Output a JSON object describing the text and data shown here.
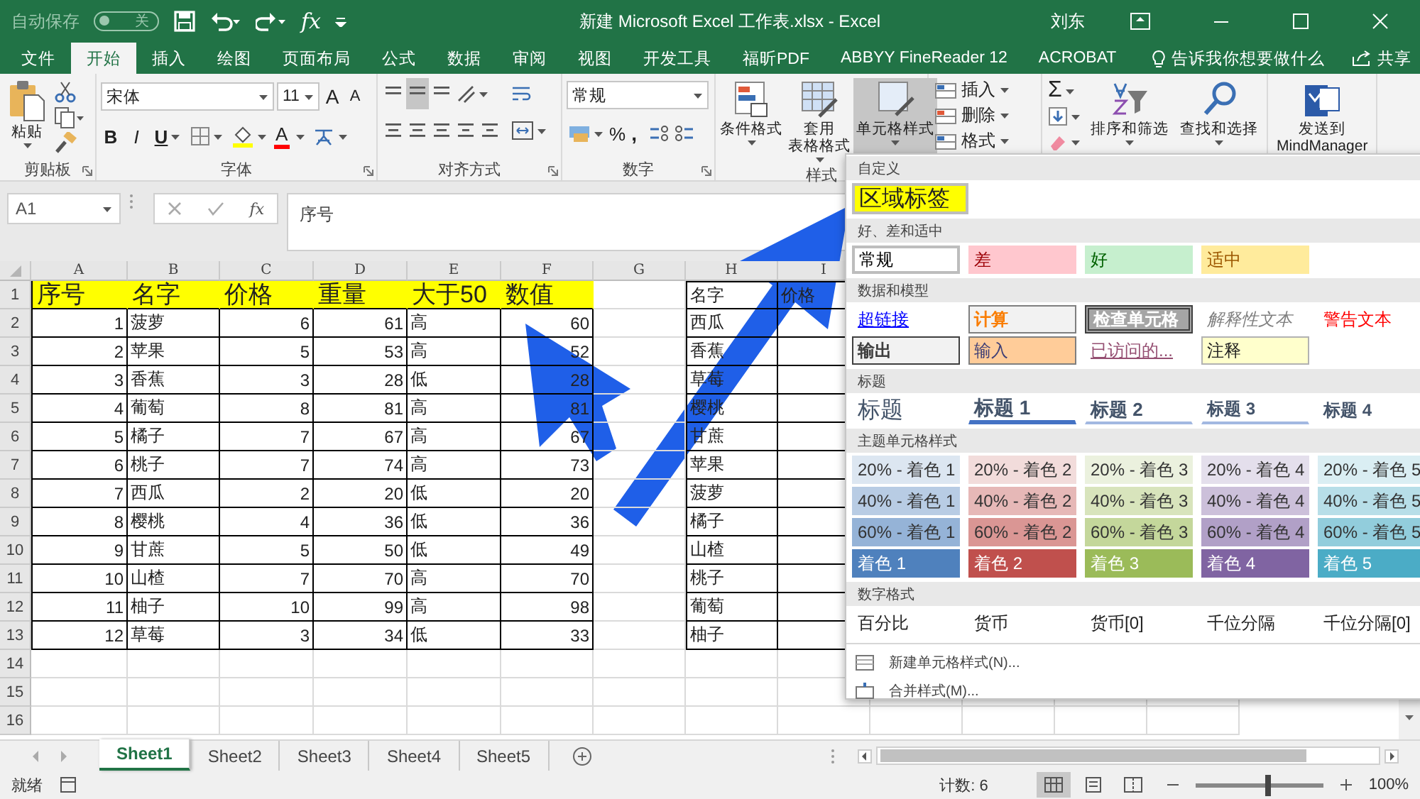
{
  "title_bar": {
    "autosave": {
      "label": "自动保存",
      "state": "关",
      "on": false
    },
    "fx": "fx",
    "title": "新建 Microsoft Excel 工作表.xlsx  -  Excel",
    "user": "刘东"
  },
  "ribbon_tabs": [
    {
      "label": "文件",
      "selected": false
    },
    {
      "label": "开始",
      "selected": true
    },
    {
      "label": "插入",
      "selected": false
    },
    {
      "label": "绘图",
      "selected": false
    },
    {
      "label": "页面布局",
      "selected": false
    },
    {
      "label": "公式",
      "selected": false
    },
    {
      "label": "数据",
      "selected": false
    },
    {
      "label": "审阅",
      "selected": false
    },
    {
      "label": "视图",
      "selected": false
    },
    {
      "label": "开发工具",
      "selected": false
    },
    {
      "label": "福昕PDF",
      "selected": false
    },
    {
      "label": "ABBYY FineReader 12",
      "selected": false
    },
    {
      "label": "ACROBAT",
      "selected": false
    }
  ],
  "tell_me": "告诉我你想要做什么",
  "share": "共享",
  "ribbon": {
    "clipboard": {
      "paste": "粘贴",
      "label": "剪贴板"
    },
    "font": {
      "name": "宋体",
      "size": "11",
      "grow": "A",
      "shrink": "A",
      "bold": "B",
      "italic": "I",
      "underline": "U",
      "color_letter": "A",
      "label": "字体"
    },
    "alignment": {
      "vertical_align": [
        {
          "selected": false
        },
        {
          "selected": true
        },
        {
          "selected": false
        }
      ],
      "label": "对齐方式"
    },
    "number": {
      "format": "常规",
      "percent": "%",
      "comma": ",",
      "label": "数字"
    },
    "styles": {
      "buttons": [
        {
          "lines": [
            "条件格式"
          ],
          "selected": false
        },
        {
          "lines": [
            "套用",
            "表格格式"
          ],
          "selected": false
        },
        {
          "lines": [
            "单元格样式"
          ],
          "selected": true
        }
      ],
      "label": "样式"
    },
    "cells": [
      "插入",
      "删除",
      "格式"
    ],
    "editing": {
      "sum": "Σ",
      "buttons": [
        "排序和筛选",
        "查找和选择"
      ]
    },
    "send_to": [
      "发送到",
      "MindManager"
    ]
  },
  "formula_bar": {
    "name_box": "A1",
    "fx": "fx",
    "formula": "序号"
  },
  "sheet": {
    "columns": [
      "A",
      "B",
      "C",
      "D",
      "E",
      "F",
      "G",
      "H",
      "I"
    ],
    "rows": [
      {
        "header": "1",
        "highlighted": true,
        "table": [
          "序号",
          "名字",
          "价格",
          "重量",
          "大于50",
          "数值"
        ],
        "list": [
          "名字",
          "价格"
        ]
      },
      {
        "header": "2",
        "highlighted": false,
        "table": [
          "1",
          "菠萝",
          "6",
          "61",
          "高",
          "60"
        ],
        "list": [
          "西瓜"
        ]
      },
      {
        "header": "3",
        "highlighted": false,
        "table": [
          "2",
          "苹果",
          "5",
          "53",
          "高",
          "52"
        ],
        "list": [
          "香蕉"
        ]
      },
      {
        "header": "4",
        "highlighted": false,
        "table": [
          "3",
          "香蕉",
          "3",
          "28",
          "低",
          "28"
        ],
        "list": [
          "草莓"
        ]
      },
      {
        "header": "5",
        "highlighted": false,
        "table": [
          "4",
          "葡萄",
          "8",
          "81",
          "高",
          "81"
        ],
        "list": [
          "樱桃"
        ]
      },
      {
        "header": "6",
        "highlighted": false,
        "table": [
          "5",
          "橘子",
          "7",
          "67",
          "高",
          "67"
        ],
        "list": [
          "甘蔗"
        ]
      },
      {
        "header": "7",
        "highlighted": false,
        "table": [
          "6",
          "桃子",
          "7",
          "74",
          "高",
          "73"
        ],
        "list": [
          "苹果"
        ]
      },
      {
        "header": "8",
        "highlighted": false,
        "table": [
          "7",
          "西瓜",
          "2",
          "20",
          "低",
          "20"
        ],
        "list": [
          "菠萝"
        ]
      },
      {
        "header": "9",
        "highlighted": false,
        "table": [
          "8",
          "樱桃",
          "4",
          "36",
          "低",
          "36"
        ],
        "list": [
          "橘子"
        ]
      },
      {
        "header": "10",
        "highlighted": false,
        "table": [
          "9",
          "甘蔗",
          "5",
          "50",
          "低",
          "49"
        ],
        "list": [
          "山楂"
        ]
      },
      {
        "header": "11",
        "highlighted": false,
        "table": [
          "10",
          "山楂",
          "7",
          "70",
          "高",
          "70"
        ],
        "list": [
          "桃子"
        ]
      },
      {
        "header": "12",
        "highlighted": false,
        "table": [
          "11",
          "柚子",
          "10",
          "99",
          "高",
          "98"
        ],
        "list": [
          "葡萄"
        ]
      },
      {
        "header": "13",
        "highlighted": false,
        "table": [
          "12",
          "草莓",
          "3",
          "34",
          "低",
          "33"
        ],
        "list": [
          "柚子"
        ]
      },
      {
        "header": "14"
      },
      {
        "header": "15"
      },
      {
        "header": "16"
      }
    ]
  },
  "sheet_tabs": [
    {
      "label": "Sheet1",
      "selected": true
    },
    {
      "label": "Sheet2",
      "selected": false
    },
    {
      "label": "Sheet3",
      "selected": false
    },
    {
      "label": "Sheet4",
      "selected": false
    },
    {
      "label": "Sheet5",
      "selected": false
    }
  ],
  "status_bar": {
    "ready": "就绪",
    "count": "计数: 6",
    "views": [
      {
        "selected": true
      },
      {
        "selected": false
      },
      {
        "selected": false
      }
    ],
    "zoom_slider": {
      "level": 0.55
    },
    "zoom": "100%"
  },
  "cell_styles_menu": {
    "sections": [
      {
        "title": "自定义",
        "items": [
          {
            "label": "区域标签",
            "kind": "custom"
          }
        ]
      },
      {
        "title": "好、差和适中",
        "items": [
          {
            "label": "常规",
            "kind": "normal"
          },
          {
            "label": "差",
            "kind": "bad"
          },
          {
            "label": "好",
            "kind": "good"
          },
          {
            "label": "适中",
            "kind": "neutral"
          }
        ]
      },
      {
        "title": "数据和模型",
        "items": [
          {
            "label": "超链接",
            "kind": "hyperlink"
          },
          {
            "label": "计算",
            "kind": "calc"
          },
          {
            "label": "检查单元格",
            "kind": "check"
          },
          {
            "label": "解释性文本",
            "kind": "explanatory"
          },
          {
            "label": "警告文本",
            "kind": "warning"
          },
          {
            "label": "输出",
            "kind": "output"
          },
          {
            "label": "输入",
            "kind": "input"
          },
          {
            "label": "已访问的...",
            "kind": "followed"
          },
          {
            "label": "注释",
            "kind": "note"
          }
        ]
      },
      {
        "title": "标题",
        "items": [
          {
            "label": "标题",
            "kind": "title"
          },
          {
            "label": "标题 1",
            "kind": "h1"
          },
          {
            "label": "标题 2",
            "kind": "h2"
          },
          {
            "label": "标题 3",
            "kind": "h3"
          },
          {
            "label": "标题 4",
            "kind": "h4"
          }
        ]
      },
      {
        "title": "主题单元格样式",
        "items": [
          {
            "label": "20% - 着色 1",
            "kind": "tint",
            "color": "#dce6f1"
          },
          {
            "label": "20% - 着色 2",
            "kind": "tint",
            "color": "#f2dcdb"
          },
          {
            "label": "20% - 着色 3",
            "kind": "tint",
            "color": "#ebf1de"
          },
          {
            "label": "20% - 着色 4",
            "kind": "tint",
            "color": "#e4dfec"
          },
          {
            "label": "20% - 着色 5",
            "kind": "tint",
            "color": "#daeef3"
          },
          {
            "label": "40% - 着色 1",
            "kind": "tint",
            "color": "#b8cce4"
          },
          {
            "label": "40% - 着色 2",
            "kind": "tint",
            "color": "#e6b8b7"
          },
          {
            "label": "40% - 着色 3",
            "kind": "tint",
            "color": "#d8e4bc"
          },
          {
            "label": "40% - 着色 4",
            "kind": "tint",
            "color": "#ccc0da"
          },
          {
            "label": "40% - 着色 5",
            "kind": "tint",
            "color": "#b7dee8"
          },
          {
            "label": "60% - 着色 1",
            "kind": "tint",
            "color": "#95b3d7"
          },
          {
            "label": "60% - 着色 2",
            "kind": "tint",
            "color": "#da9694"
          },
          {
            "label": "60% - 着色 3",
            "kind": "tint",
            "color": "#c4d79b"
          },
          {
            "label": "60% - 着色 4",
            "kind": "tint",
            "color": "#b1a0c7"
          },
          {
            "label": "60% - 着色 5",
            "kind": "tint",
            "color": "#92cddc"
          },
          {
            "label": "着色 1",
            "kind": "accent",
            "color": "#4f81bd"
          },
          {
            "label": "着色 2",
            "kind": "accent",
            "color": "#c0504d"
          },
          {
            "label": "着色 3",
            "kind": "accent",
            "color": "#9bbb59"
          },
          {
            "label": "着色 4",
            "kind": "accent",
            "color": "#8064a2"
          },
          {
            "label": "着色 5",
            "kind": "accent",
            "color": "#4bacc6"
          }
        ]
      },
      {
        "title": "数字格式",
        "items": [
          {
            "label": "百分比",
            "kind": "number"
          },
          {
            "label": "货币",
            "kind": "number"
          },
          {
            "label": "货币[0]",
            "kind": "number"
          },
          {
            "label": "千位分隔",
            "kind": "number"
          },
          {
            "label": "千位分隔[0]",
            "kind": "number"
          }
        ]
      }
    ],
    "actions": [
      {
        "label": "新建单元格样式(N)...",
        "kind": "new"
      },
      {
        "label": "合并样式(M)...",
        "kind": "merge"
      }
    ]
  }
}
